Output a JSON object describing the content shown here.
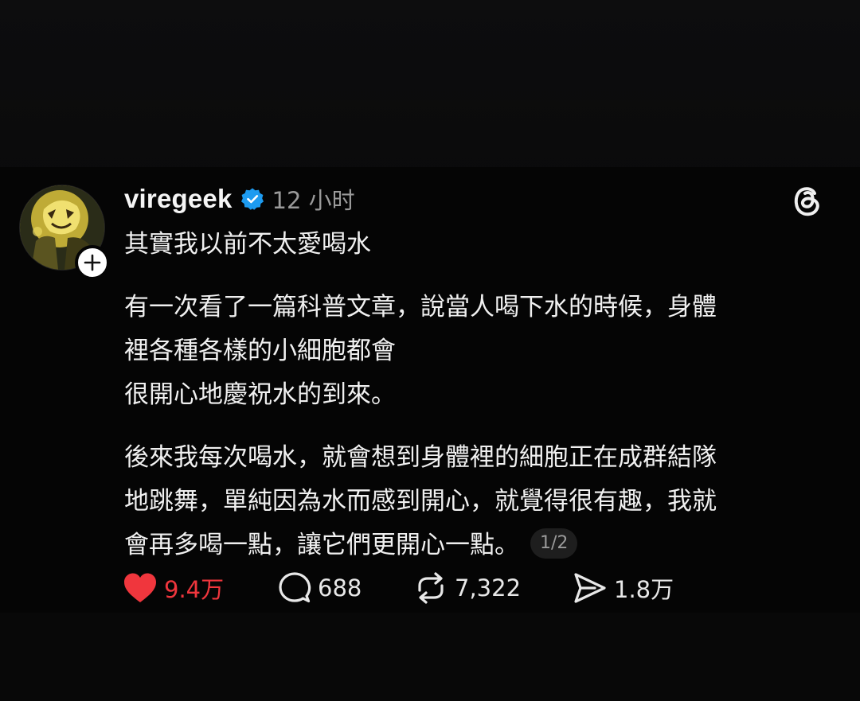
{
  "post": {
    "username": "viregeek",
    "time": "12 小时",
    "paragraphs": [
      [
        "其實我以前不太愛喝水"
      ],
      [
        "有一次看了一篇科普文章，說當人喝下水的時候，身體",
        "裡各種各樣的小細胞都會",
        "很開心地慶祝水的到來。"
      ],
      [
        "後來我每次喝水，就會想到身體裡的細胞正在成群結隊",
        "地跳舞，單純因為水而感到開心，就覺得很有趣，我就",
        "會再多喝一點，讓它們更開心一點。"
      ]
    ],
    "pager": "1/2"
  },
  "actions": {
    "likes": "9.4万",
    "replies": "688",
    "reposts": "7,322",
    "shares": "1.8万"
  },
  "colors": {
    "like": "#f0363d",
    "verified": "#1d9bf0",
    "background": "#050505"
  },
  "icons": {
    "verified": "verified-badge-icon",
    "threads": "threads-logo-icon",
    "follow": "plus-icon",
    "like": "heart-icon",
    "reply": "comment-icon",
    "repost": "repost-icon",
    "share": "send-icon"
  }
}
